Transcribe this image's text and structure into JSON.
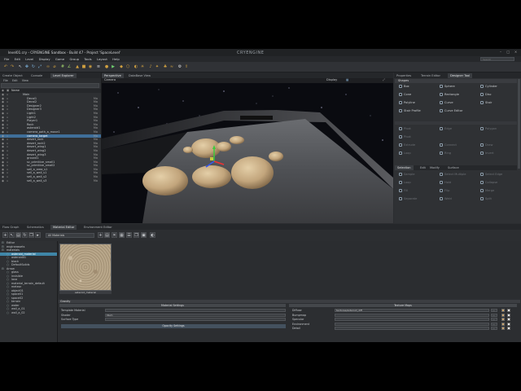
{
  "window": {
    "title": "level01.cry - CRYENGINE Sandbox - Build 47 - Project 'SpaceLevel'",
    "brand": "CRYENGINE",
    "controls": [
      "–",
      "□",
      "×"
    ]
  },
  "menu": {
    "items": [
      "File",
      "Edit",
      "Level",
      "Display",
      "Game",
      "Group",
      "Tools",
      "Layout",
      "Help"
    ],
    "search_placeholder": "Search"
  },
  "left_panel": {
    "tabs": [
      "Create Object",
      "Console",
      "Level Explorer"
    ],
    "active_tab": "Level Explorer",
    "submenu": [
      "File",
      "Edit",
      "View"
    ],
    "column_name": "Name",
    "rows": [
      {
        "name": "Main",
        "type": "",
        "selected": false
      },
      {
        "name": "Decal1",
        "type": "Ma",
        "selected": false
      },
      {
        "name": "Decal2",
        "type": "Ma",
        "selected": false
      },
      {
        "name": "Designer2",
        "type": "Ma",
        "selected": false
      },
      {
        "name": "Designer3",
        "type": "Ma",
        "selected": false
      },
      {
        "name": "Light1",
        "type": "Ma",
        "selected": false
      },
      {
        "name": "Light2",
        "type": "Ma",
        "selected": false
      },
      {
        "name": "Player1",
        "type": "Ma",
        "selected": false
      },
      {
        "name": "Rock",
        "type": "Ma",
        "selected": false
      },
      {
        "name": "asteroid1",
        "type": "Ma",
        "selected": false
      },
      {
        "name": "camera_path_a_move1",
        "type": "Ma",
        "selected": false
      },
      {
        "name": "camera_target",
        "type": "Ma",
        "selected": true
      },
      {
        "name": "desert_rock",
        "type": "Ma",
        "selected": false
      },
      {
        "name": "desert_rock2",
        "type": "Ma",
        "selected": false
      },
      {
        "name": "desert_wing1",
        "type": "Ma",
        "selected": false
      },
      {
        "name": "desert_wing2",
        "type": "Ma",
        "selected": false
      },
      {
        "name": "desert_wing3",
        "type": "Ma",
        "selected": false
      },
      {
        "name": "ground1",
        "type": "Ma",
        "selected": false
      },
      {
        "name": "sc_primitive_small1",
        "type": "Ma",
        "selected": false
      },
      {
        "name": "sc_primitive_small2",
        "type": "Ma",
        "selected": false
      },
      {
        "name": "sell_a_area_s1",
        "type": "Ma",
        "selected": false
      },
      {
        "name": "sell_a_wall_s1",
        "type": "Ma",
        "selected": false
      },
      {
        "name": "sell_a_wall_s2",
        "type": "Ma",
        "selected": false
      },
      {
        "name": "sell_a_wall_s3",
        "type": "Ma",
        "selected": false
      }
    ]
  },
  "viewport": {
    "tabs": [
      "Perspective",
      "DataBase View"
    ],
    "active_tab": "Perspective",
    "camera_label": "Camera",
    "display_label": "Display"
  },
  "right_panel": {
    "tabs": [
      "Properties",
      "Terrain Editor",
      "Designer Tool"
    ],
    "active_tab": "Designer Tool",
    "shapes_header": "Shapes",
    "shapes": [
      [
        "Box",
        "Sphere",
        "Cylinder"
      ],
      [
        "Cone",
        "Rectangle",
        "Disc"
      ],
      [
        "Polyline",
        "Curve",
        "Stair"
      ],
      [
        "Stair Profile",
        "Curve Editor",
        ""
      ]
    ],
    "edit_tools": [
      [
        "Pivot",
        "Edge",
        "Polygon"
      ],
      [
        "Pivot",
        "",
        ""
      ],
      [
        "Extrude",
        "Connect",
        "Draw"
      ],
      [
        "Loop",
        "Ring",
        "Invert"
      ]
    ],
    "subtabs": [
      "Selection",
      "Edit",
      "Modify",
      "Surface"
    ],
    "lower_tools": [
      [
        "Sample",
        "Select Multiple",
        "Select Edge"
      ],
      [
        "Loop",
        "Hold",
        "Collapse"
      ],
      [
        "Fill",
        "Flip",
        "Merge"
      ],
      [
        "Separate",
        "Weld",
        "Split"
      ]
    ]
  },
  "bottom": {
    "tabs": [
      "Flow Graph",
      "Schematics",
      "Material Editor",
      "Environment Editor"
    ],
    "active_tab": "Material Editor",
    "material_filter": "All Materials",
    "material_tree": [
      {
        "name": "Editor",
        "selected": false
      },
      {
        "name": "engineassets",
        "selected": false
      },
      {
        "name": "materials",
        "selected": false
      },
      {
        "name": "asteroid_material",
        "selected": true
      },
      {
        "name": "asteroid01",
        "selected": false
      },
      {
        "name": "black",
        "selected": false
      },
      {
        "name": "DefaultSolids",
        "selected": false
      },
      {
        "name": "Arrow",
        "selected": false
      },
      {
        "name": "glass",
        "selected": false
      },
      {
        "name": "invisible",
        "selected": false
      },
      {
        "name": "lava",
        "selected": false
      },
      {
        "name": "material_terrain_default",
        "selected": false
      },
      {
        "name": "meteor",
        "selected": false
      },
      {
        "name": "object01",
        "selected": false
      },
      {
        "name": "space01",
        "selected": false
      },
      {
        "name": "space02",
        "selected": false
      },
      {
        "name": "terrain",
        "selected": false
      },
      {
        "name": "water",
        "selected": false
      },
      {
        "name": "wall_a_01",
        "selected": false
      },
      {
        "name": "wall_a_02",
        "selected": false
      }
    ],
    "thumbnail_caption": "asteroid_material",
    "props": {
      "header": "Gravity",
      "material_settings": "Material Settings",
      "texture_maps": "Texture Maps",
      "rows_left": [
        {
          "label": "Template Material",
          "value": ""
        },
        {
          "label": "Shader",
          "value": "Illum"
        },
        {
          "label": "Surface Type",
          "value": ""
        }
      ],
      "opacity_button": "Opacity Settings",
      "rows_right": [
        {
          "label": "Diffuse",
          "value": "textures/asteroid_diff"
        },
        {
          "label": "Bumpmap",
          "value": ""
        },
        {
          "label": "Specular",
          "value": ""
        },
        {
          "label": "Environment",
          "value": ""
        },
        {
          "label": "Detail",
          "value": ""
        }
      ]
    }
  },
  "colors": {
    "selection": "#3f6f9a",
    "material_selection": "#3f86a8",
    "accent": "#d0a040"
  }
}
